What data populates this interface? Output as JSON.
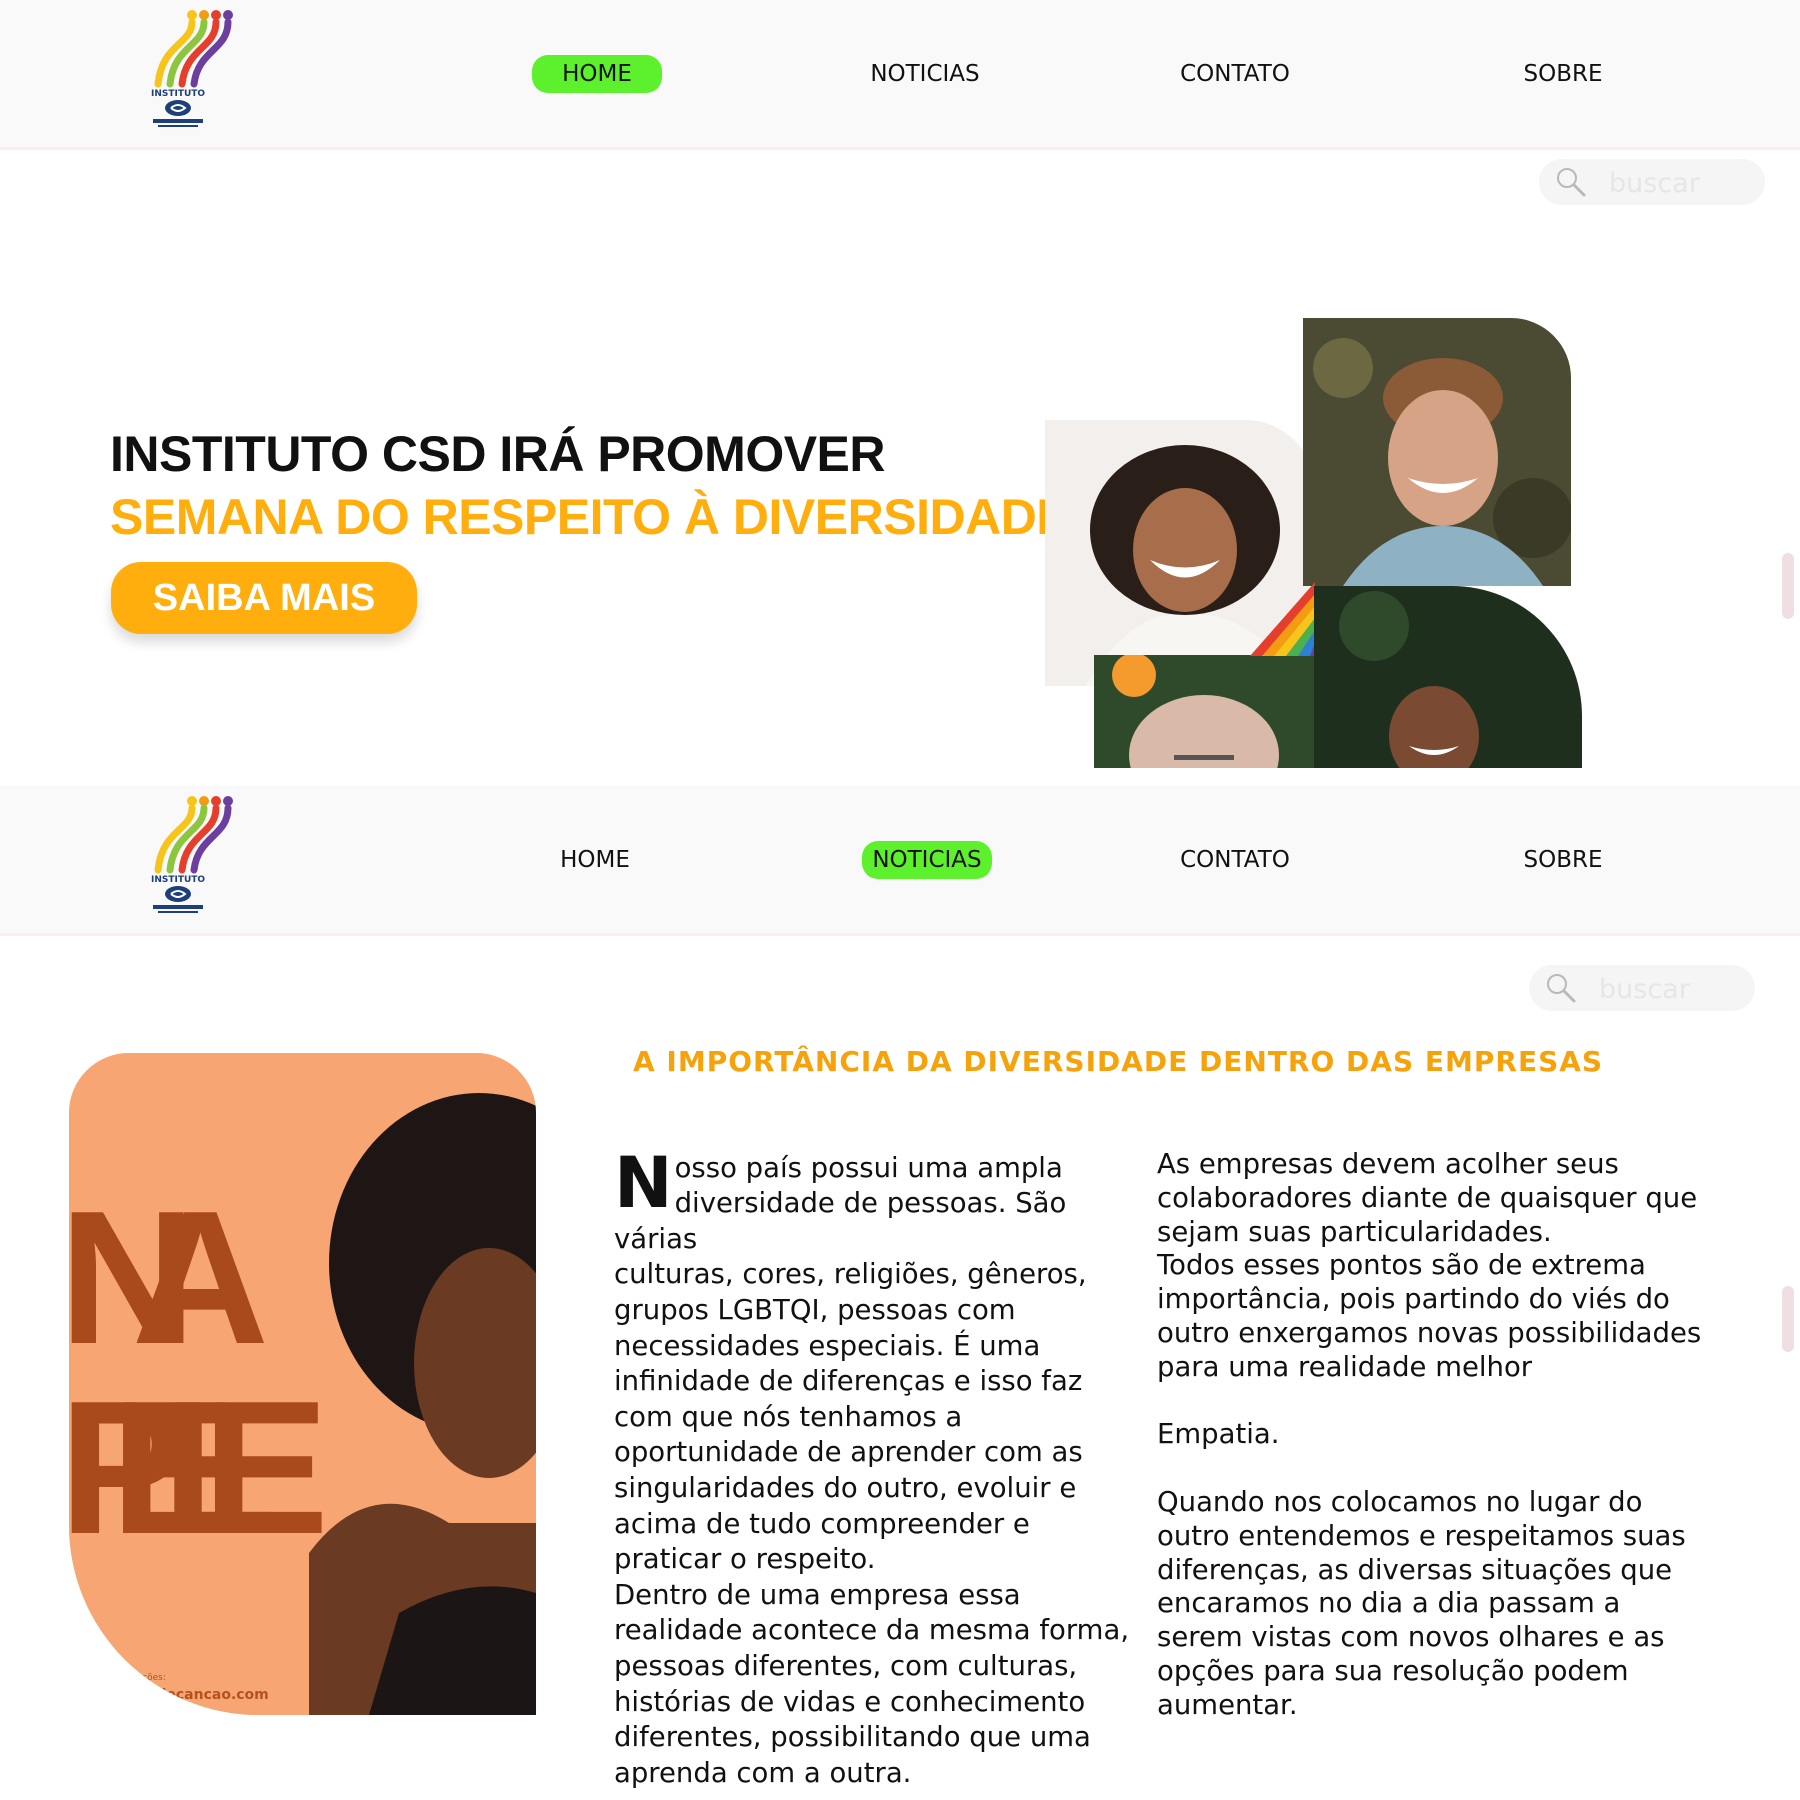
{
  "header_top": {
    "logo_text": "INSTITUTO",
    "nav": [
      "HOME",
      "NOTICIAS",
      "CONTATO",
      "SOBRE"
    ],
    "active": "HOME",
    "search_placeholder": "buscar"
  },
  "hero": {
    "line1": "INSTITUTO CSD IRÁ PROMOVER",
    "line2": "SEMANA DO RESPEITO À DIVERSIDADE",
    "button": "SAIBA MAIS"
  },
  "header_bottom": {
    "logo_text": "INSTITUTO",
    "nav": [
      "HOME",
      "NOTICIAS",
      "CONTATO",
      "SOBRE"
    ],
    "active": "NOTICIAS",
    "search_placeholder": "buscar"
  },
  "article": {
    "title": "A IMPORTÂNCIA DA DIVERSIDADE DENTRO DAS EMPRESAS",
    "image_text_1": "NA",
    "image_text_2": "PELE",
    "image_caption_small": "Mais Informações:",
    "image_caption_link": "blog.cidadecancao.com",
    "col1_dropcap": "N",
    "col1_text": "osso país possui uma ampla\ndiversidade de pessoas. São várias\nculturas, cores, religiões, gêneros,\ngrupos LGBTQI, pessoas com\nnecessidades especiais. É uma\ninfinidade de diferenças e isso faz\ncom que nós tenhamos a\noportunidade de aprender com as\nsingularidades do outro, evoluir e\nacima de tudo compreender e\npraticar o respeito.\nDentro de uma empresa essa\nrealidade acontece da mesma forma,\npessoas diferentes, com culturas,\nhistórias de vidas e conhecimento\ndiferentes, possibilitando que uma\naprenda com a outra.",
    "col2_p1": " As empresas devem acolher seus\ncolaboradores diante de quaisquer que\nsejam suas particularidades.\nTodos esses pontos são de extrema\nimportância, pois partindo do viés do\noutro enxergamos novas possibilidades\npara uma realidade melhor",
    "col2_p2": "Empatia.",
    "col2_p3": "Quando nos colocamos no lugar do\noutro entendemos e respeitamos suas\ndiferenças, as diversas situações que\nencaramos no dia a dia passam a\nserem vistas com novos olhares  e as\nopções para sua resolução podem\naumentar."
  },
  "colors": {
    "accent_orange": "#ffae0d",
    "nav_active_green": "#5cf12c",
    "title_orange": "#f5a20b"
  },
  "icons": [
    "logo-icon",
    "search-icon"
  ]
}
